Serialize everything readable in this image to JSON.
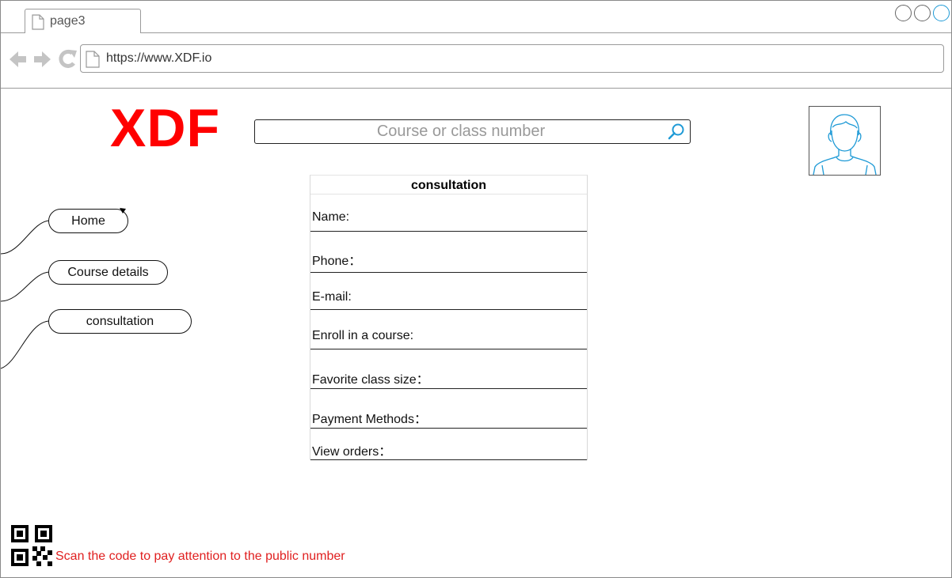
{
  "browser": {
    "tab_label": "page3",
    "url": "https://www.XDF.io"
  },
  "header": {
    "logo": "XDF",
    "search_placeholder": "Course or class number"
  },
  "sidebar": {
    "items": [
      {
        "label": "Home"
      },
      {
        "label": "Course details"
      },
      {
        "label": "consultation"
      }
    ]
  },
  "form": {
    "title": "consultation",
    "fields": [
      {
        "label": "Name:"
      },
      {
        "label": "Phone："
      },
      {
        "label": "E-mail:"
      },
      {
        "label": "Enroll in a course:"
      },
      {
        "label": "Favorite class size："
      },
      {
        "label": "Payment Methods："
      },
      {
        "label": "View orders："
      }
    ]
  },
  "footer": {
    "text": "Scan the code to pay attention to the public number"
  },
  "colors": {
    "logo": "#ff0000",
    "footer_text": "#e02020",
    "accent": "#1e9ad6"
  }
}
